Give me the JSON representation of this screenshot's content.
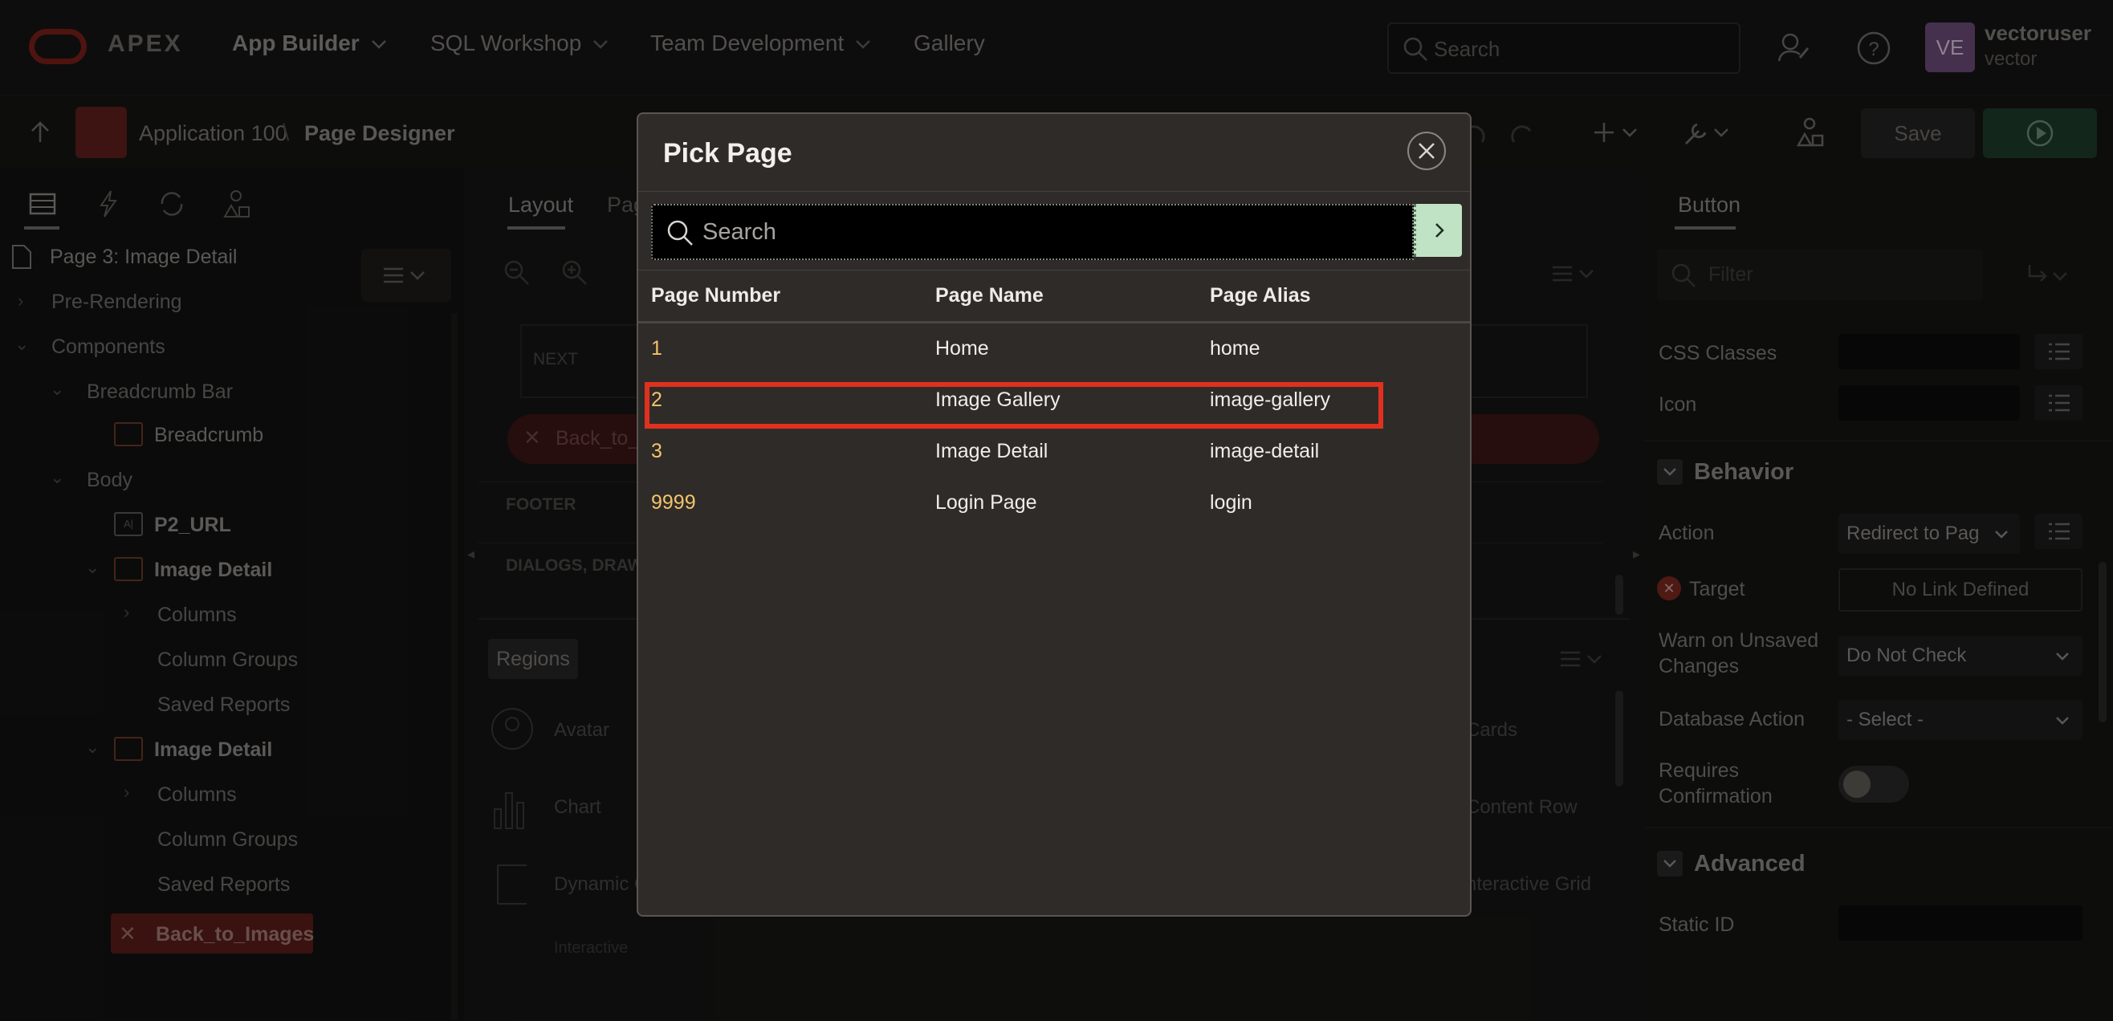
{
  "app": {
    "logo_text": "APEX",
    "nav": [
      {
        "label": "App Builder"
      },
      {
        "label": "SQL Workshop"
      },
      {
        "label": "Team Development"
      },
      {
        "label": "Gallery"
      }
    ],
    "search_placeholder": "Search",
    "user": {
      "initials": "VE",
      "name": "vectoruser",
      "workspace": "vector"
    }
  },
  "toolbar": {
    "breadcrumb_app": "Application 100",
    "breadcrumb_page": "Page Designer",
    "save_label": "Save"
  },
  "left_panel": {
    "page_title": "Page 3: Image Detail",
    "tree": [
      {
        "label": "Pre-Rendering"
      },
      {
        "label": "Components"
      },
      {
        "label": "Breadcrumb Bar"
      },
      {
        "label": "Breadcrumb"
      },
      {
        "label": "Body"
      },
      {
        "label": "P2_URL"
      },
      {
        "label": "Image Detail"
      },
      {
        "label": "Columns"
      },
      {
        "label": "Column Groups"
      },
      {
        "label": "Saved Reports"
      },
      {
        "label": "Image Detail"
      },
      {
        "label": "Columns"
      },
      {
        "label": "Column Groups"
      },
      {
        "label": "Saved Reports"
      },
      {
        "label": "Back_to_Images"
      }
    ]
  },
  "center": {
    "tab_layout": "Layout",
    "tab_page": "Pag",
    "next_label": "NEXT",
    "back_btn_label": "Back_to_",
    "footer_label": "FOOTER",
    "dialogs_label": "DIALOGS, DRAWE",
    "regions_tab": "Regions",
    "gallery_left": [
      "Avatar",
      "Chart",
      "Dynamic C",
      "Interactive"
    ],
    "gallery_right": [
      "Cards",
      "Content Row",
      "nteractive Grid"
    ]
  },
  "right_panel": {
    "tab": "Button",
    "filter_placeholder": "Filter",
    "css_classes": "CSS Classes",
    "icon": "Icon",
    "behavior": "Behavior",
    "action_label": "Action",
    "action_value": "Redirect to Pag",
    "target_label": "Target",
    "target_value": "No Link Defined",
    "warn_label_1": "Warn on Unsaved",
    "warn_label_2": "Changes",
    "warn_value": "Do Not Check",
    "db_action_label": "Database Action",
    "db_action_value": "- Select -",
    "requires_1": "Requires",
    "requires_2": "Confirmation",
    "advanced": "Advanced",
    "static_id": "Static ID"
  },
  "dialog": {
    "title": "Pick Page",
    "search_placeholder": "Search",
    "columns": [
      "Page Number",
      "Page Name",
      "Page Alias"
    ],
    "rows": [
      {
        "number": "1",
        "name": "Home",
        "alias": "home"
      },
      {
        "number": "2",
        "name": "Image Gallery",
        "alias": "image-gallery"
      },
      {
        "number": "3",
        "name": "Image Detail",
        "alias": "image-detail"
      },
      {
        "number": "9999",
        "name": "Login Page",
        "alias": "login"
      }
    ],
    "highlight_color": "#e0311f",
    "number_color": "#f3c46b"
  }
}
